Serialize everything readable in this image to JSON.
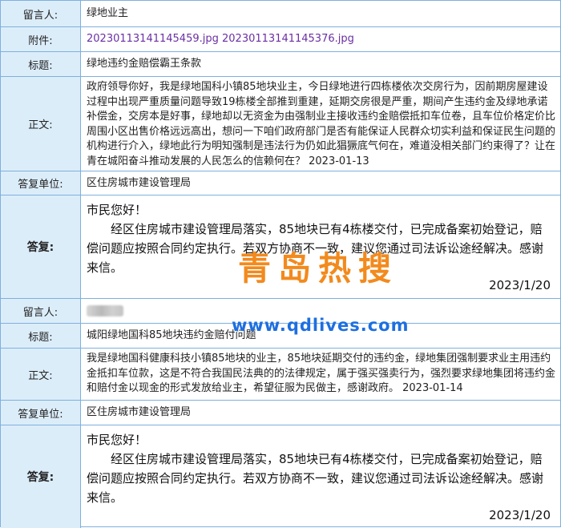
{
  "record1": {
    "author_label": "留言人:",
    "author": "绿地业主",
    "attachment_label": "附件:",
    "attachment1": "20230113141145459.jpg",
    "attachment2": "20230113141145376.jpg",
    "title_label": "标题:",
    "title": "绿地违约金赔偿霸王条款",
    "body_label": "正文:",
    "body": "政府领导你好，我是绿地国科小镇85地块业主，今日绿地进行四栋楼依次交房行为，因前期房屋建设过程中出现严重质量问题导致19栋楼全部推到重建，延期交房很是严重，期间产生违约金及绿地承诺补偿金，交房本是好事，绿地却以无资金为由强制业主接收违约金赔偿抵扣车位卷，且车位价格定价比周围小区出售价格远远高出，想问一下咱们政府部门是否有能保证人民群众切实利益和保证民生问题的机构进行介入，绿地此行为明知强制是违法行为仍如此猖獗底气何在，难道没相关部门约束得了？让在青在城阳奋斗推动发展的人民怎么的信赖何在？  2023-01-13",
    "unit_label": "答复单位:",
    "unit": "区住房城市建设管理局",
    "reply_label": "答复:",
    "reply_greeting": "市民您好！",
    "reply_body": "经区住房城市建设管理局落实，85地块已有4栋楼交付，已完成备案初始登记，赔偿问题应按照合同约定执行。若双方协商不一致，建议您通过司法诉讼途经解决。感谢来信。",
    "reply_date": "2023/1/20"
  },
  "record2": {
    "author_label": "留言人:",
    "title_label": "标题:",
    "title": "城阳绿地国科85地块违约金赔付问题",
    "body_label": "正文:",
    "body": "我是绿地国科健康科技小镇85地块的业主，85地块延期交付的违约金，绿地集团强制要求业主用违约金抵扣车位款，这是不符合我国民法典的的法律规定，属于强买强卖行为，强烈要求绿地集团将违约金和赔付金以现金的形式发放给业主，希望征服为民做主，感谢政府。  2023-01-14",
    "unit_label": "答复单位:",
    "unit": "区住房城市建设管理局",
    "reply_label": "答复:",
    "reply_greeting": "市民您好！",
    "reply_body": "经区住房城市建设管理局落实，85地块已有4栋楼交付，已完成备案初始登记，赔偿问题应按照合同约定执行。若双方协商不一致，建议您通过司法诉讼途经解决。感谢来信。",
    "reply_date": "2023/1/20"
  },
  "watermark": {
    "brand": "青岛热搜",
    "url": "www.qdlives.com",
    "brand_color": "#f28a1d",
    "url_color": "#1d6fe0"
  }
}
